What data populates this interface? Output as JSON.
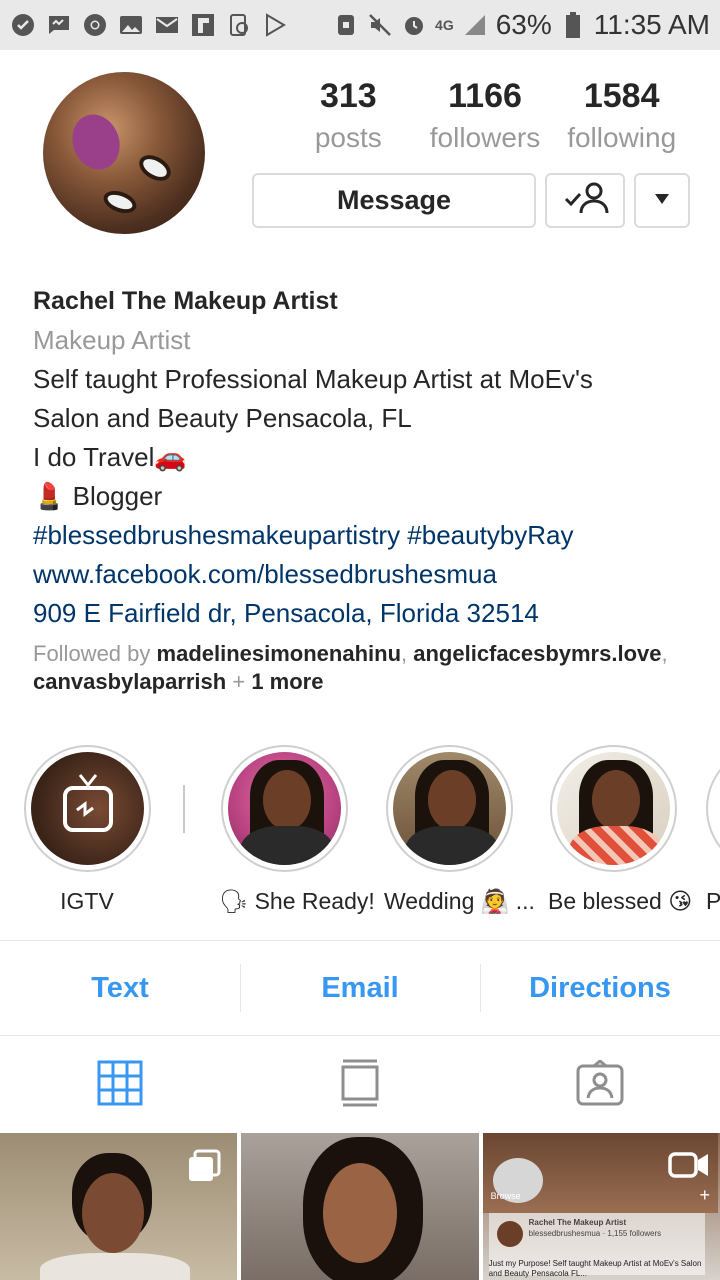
{
  "status_bar": {
    "battery": "63%",
    "time": "11:35 AM",
    "network": "4G"
  },
  "profile": {
    "posts_count": "313",
    "posts_label": "posts",
    "followers_count": "1166",
    "followers_label": "followers",
    "following_count": "1584",
    "following_label": "following",
    "message_label": "Message"
  },
  "bio": {
    "name": "Rachel The Makeup Artist",
    "category": "Makeup Artist",
    "line1": "Self taught Professional Makeup Artist at MoEv's",
    "line2": "Salon and Beauty Pensacola, FL",
    "line3": "I do Travel🚗",
    "line4": "💄 Blogger",
    "hashtags": "#blessedbrushesmakeupartistry #beautybyRay",
    "website": "www.facebook.com/blessedbrushesmua",
    "address": "909 E Fairfield dr, Pensacola, Florida 32514"
  },
  "followed_by": {
    "prefix": "Followed by ",
    "user1": "madelinesimonenahinu",
    "sep1": ", ",
    "user2": "angelicfacesbymrs.love",
    "sep2": ",",
    "user3": "canvasbylaparrish",
    "plus": " + ",
    "more": "1 more"
  },
  "highlights": [
    {
      "label": "IGTV"
    },
    {
      "label": "🗣 She Ready!"
    },
    {
      "label": "Wedding 👰 ..."
    },
    {
      "label": "Be blessed 😘"
    },
    {
      "label": "P"
    }
  ],
  "contact": {
    "text": "Text",
    "email": "Email",
    "directions": "Directions"
  },
  "grid_post3": {
    "name": "Rachel The Makeup Artist",
    "sub": "blessedbrushesmua · 1,155 followers",
    "browse": "Browse",
    "caption": "Just my Purpose! Self taught Makeup Artist at MoEv's Salon and Beauty Pensacola FL..."
  },
  "colors": {
    "link_blue": "#3897f0",
    "bio_link": "#003569",
    "muted": "#999999",
    "text": "#262626"
  }
}
